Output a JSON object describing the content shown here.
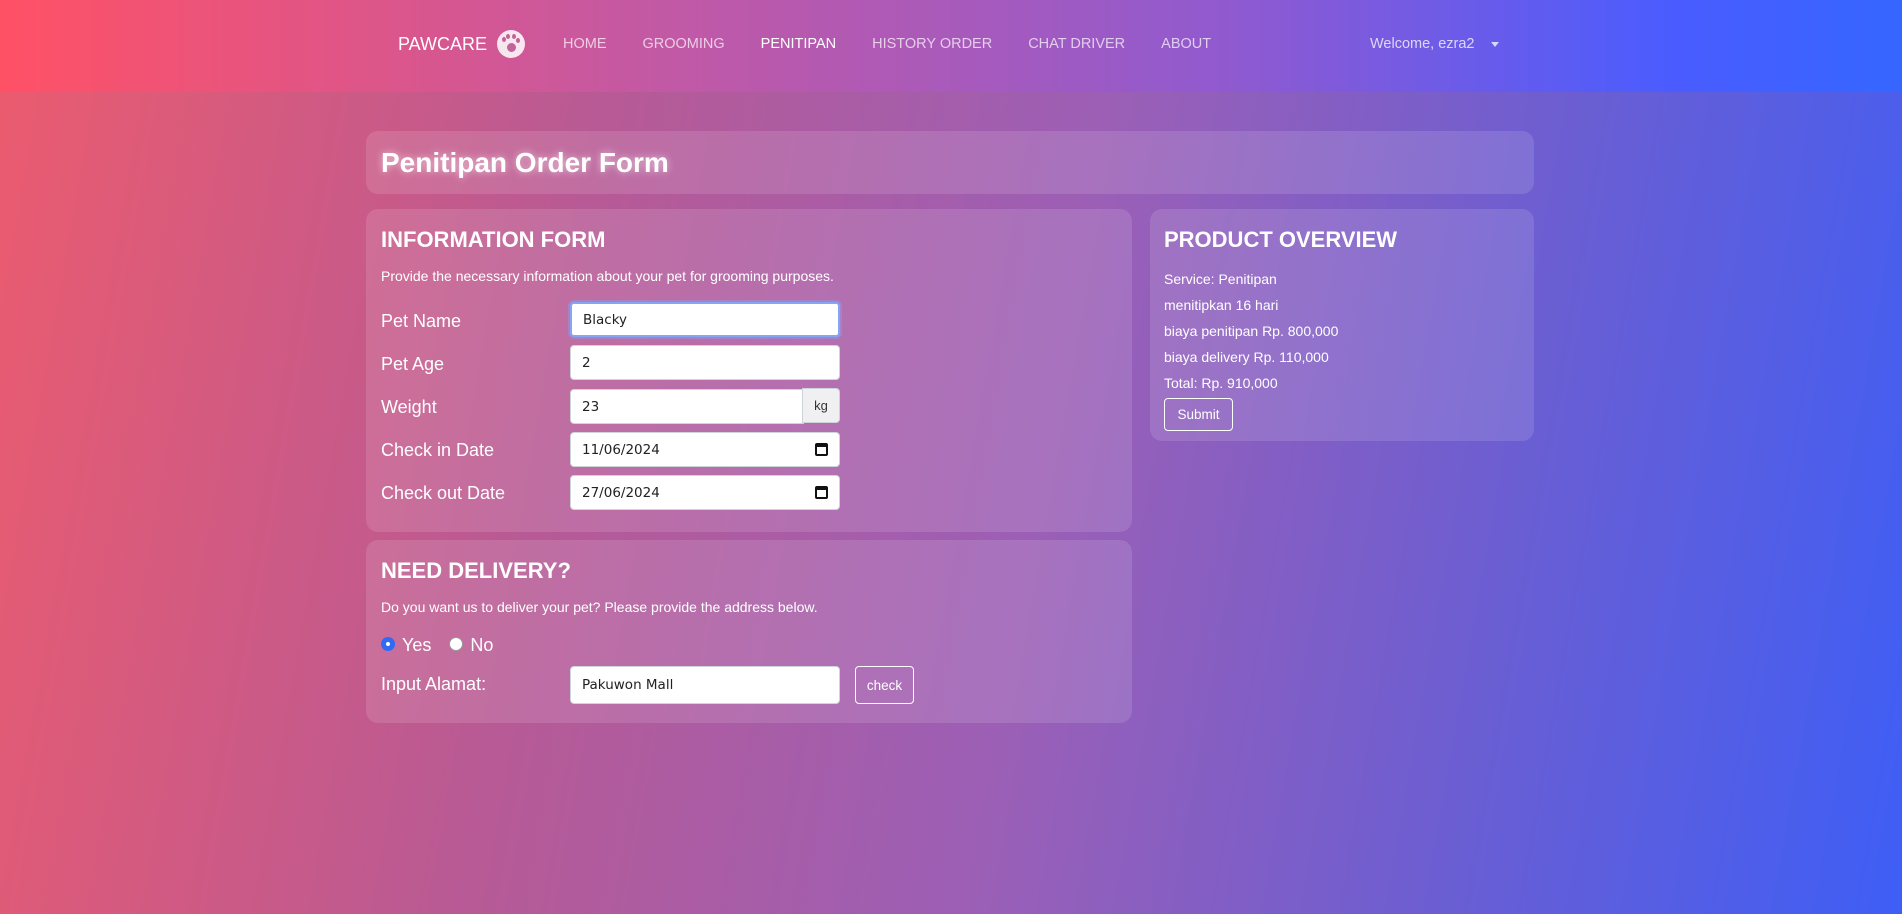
{
  "nav": {
    "brand": "PAWCARE",
    "brand_icon": "paw-icon",
    "links": [
      "HOME",
      "GROOMING",
      "PENITIPAN",
      "HISTORY ORDER",
      "CHAT DRIVER",
      "ABOUT"
    ],
    "active": "PENITIPAN",
    "user": "Welcome, ezra2"
  },
  "page": {
    "title": "Penitipan Order Form"
  },
  "info_form": {
    "heading": "INFORMATION FORM",
    "description": "Provide the necessary information about your pet for grooming purposes.",
    "pet_name_label": "Pet Name",
    "pet_name_value": "Blacky",
    "pet_age_label": "Pet Age",
    "pet_age_value": "2",
    "weight_label": "Weight",
    "weight_value": "23",
    "weight_unit": "kg",
    "checkin_label": "Check in Date",
    "checkin_value": "11/06/2024",
    "checkout_label": "Check out Date",
    "checkout_value": "27/06/2024"
  },
  "delivery": {
    "heading": "NEED DELIVERY?",
    "description": "Do you want us to deliver your pet? Please provide the address below.",
    "option_yes": "Yes",
    "option_no": "No",
    "selected": "Yes",
    "address_label": "Input Alamat:",
    "address_value": "Pakuwon Mall",
    "check_button": "check"
  },
  "overview": {
    "heading": "PRODUCT OVERVIEW",
    "service": "Service: Penitipan",
    "duration": "menitipkan 16 hari",
    "boarding_cost": "biaya penitipan Rp. 800,000",
    "delivery_cost": "biaya delivery Rp. 110,000",
    "total": "Total: Rp. 910,000",
    "submit": "Submit"
  },
  "colors": {
    "gradient_start": "#ec5b6e",
    "gradient_end": "#3e5ef6",
    "radio_accent": "#2f6af5"
  }
}
